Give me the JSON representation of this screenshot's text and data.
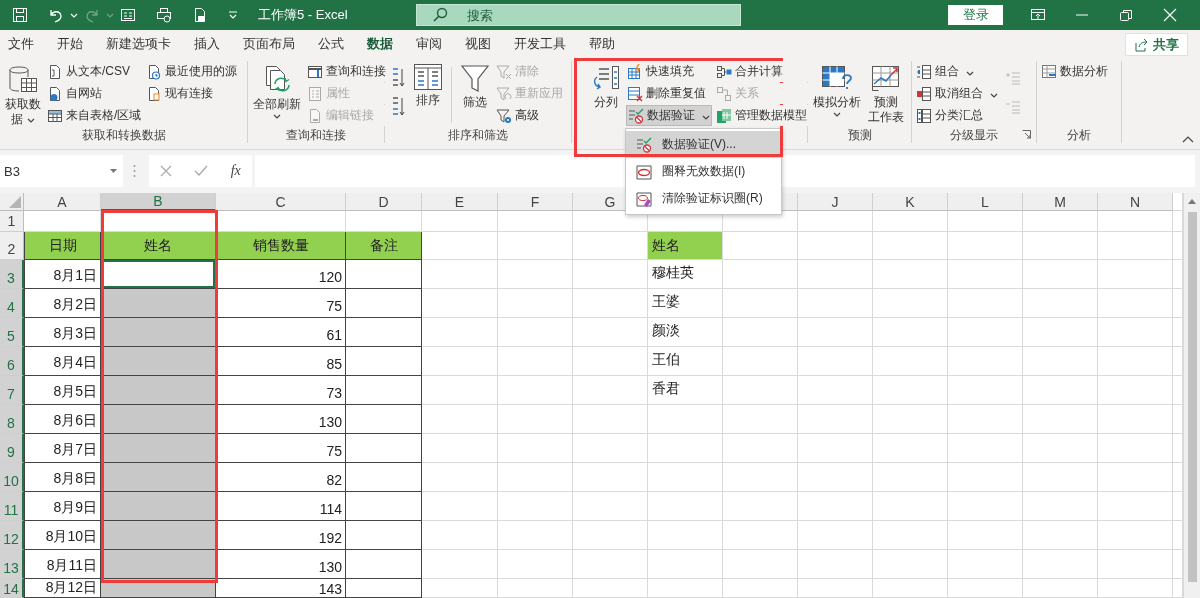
{
  "title_bar": {
    "title": "工作簿5 - Excel",
    "search_placeholder": "搜索",
    "sign_in": "登录"
  },
  "tabs": [
    {
      "label": "文件",
      "selected": false
    },
    {
      "label": "开始",
      "selected": false
    },
    {
      "label": "新建选项卡",
      "selected": false
    },
    {
      "label": "插入",
      "selected": false
    },
    {
      "label": "页面布局",
      "selected": false
    },
    {
      "label": "公式",
      "selected": false
    },
    {
      "label": "数据",
      "selected": true
    },
    {
      "label": "审阅",
      "selected": false
    },
    {
      "label": "视图",
      "selected": false
    },
    {
      "label": "开发工具",
      "selected": false
    },
    {
      "label": "帮助",
      "selected": false
    }
  ],
  "share": "共享",
  "ribbon": {
    "groups": [
      {
        "label": "获取和转换数据",
        "columns": [
          {
            "kind": "large",
            "lines": [
              "获取数",
              "据"
            ],
            "dropdown": true
          },
          {
            "kind": "stack",
            "items": [
              {
                "label": "从文本/CSV",
                "disabled": false
              },
              {
                "label": "自网站",
                "disabled": false
              },
              {
                "label": "来自表格/区域",
                "disabled": false
              }
            ]
          },
          {
            "kind": "stack",
            "items": [
              {
                "label": "最近使用的源",
                "disabled": false
              },
              {
                "label": "现有连接",
                "disabled": false
              }
            ]
          }
        ]
      },
      {
        "label": "查询和连接",
        "columns": [
          {
            "kind": "large",
            "lines": [
              "全部刷新"
            ],
            "dropdown": true
          },
          {
            "kind": "stack",
            "items": [
              {
                "label": "查询和连接",
                "disabled": false
              },
              {
                "label": "属性",
                "disabled": true
              },
              {
                "label": "编辑链接",
                "disabled": true
              }
            ]
          }
        ]
      },
      {
        "label": "排序和筛选",
        "columns": [
          {
            "kind": "icon_stack",
            "items": [
              {
                "disabled": false
              },
              {
                "disabled": false
              }
            ]
          },
          {
            "kind": "large",
            "lines": [
              "排序"
            ],
            "dropdown": false
          },
          {
            "kind": "separator"
          },
          {
            "kind": "large",
            "lines": [
              "筛选"
            ],
            "dropdown": false
          },
          {
            "kind": "stack",
            "items": [
              {
                "label": "清除",
                "disabled": true
              },
              {
                "label": "重新应用",
                "disabled": true
              },
              {
                "label": "高级",
                "disabled": false
              }
            ]
          }
        ]
      },
      {
        "columns": [
          {
            "kind": "large",
            "lines": [
              "分列"
            ],
            "dropdown": false
          },
          {
            "kind": "stack",
            "items": [
              {
                "label": "快速填充",
                "disabled": false
              },
              {
                "label": "删除重复值",
                "disabled": false
              },
              {
                "label": "数据验证",
                "disabled": false,
                "dropdown": true,
                "menu": {
                  "items": [
                    {
                      "label": "数据验证(V)...",
                      "selected": true
                    },
                    {
                      "label": "圈释无效数据(I)",
                      "selected": false
                    },
                    {
                      "label": "清除验证标识圈(R)",
                      "selected": false
                    }
                  ]
                }
              }
            ]
          },
          {
            "kind": "stack",
            "items": [
              {
                "label": "合并计算",
                "disabled": false
              },
              {
                "label": "关系",
                "disabled": true
              },
              {
                "label": "管理数据模型",
                "disabled": false
              }
            ]
          }
        ]
      },
      {
        "label": "预测",
        "columns": [
          {
            "kind": "large",
            "lines": [
              "模拟分析"
            ],
            "dropdown": true
          },
          {
            "kind": "large",
            "lines": [
              "预测",
              "工作表"
            ],
            "dropdown": false
          }
        ]
      },
      {
        "label": "分级显示",
        "launcher": true,
        "columns": [
          {
            "kind": "stack",
            "items": [
              {
                "label": "组合",
                "disabled": false,
                "dropdown": true
              },
              {
                "label": "取消组合",
                "disabled": false,
                "dropdown": true
              },
              {
                "label": "分类汇总",
                "disabled": false
              }
            ]
          },
          {
            "kind": "icon_stack",
            "items": [
              {
                "disabled": true
              },
              {
                "disabled": true
              }
            ]
          }
        ]
      },
      {
        "label": "分析",
        "columns": [
          {
            "kind": "stack",
            "items": [
              {
                "label": "数据分析",
                "disabled": false
              }
            ]
          }
        ]
      }
    ]
  },
  "formula_bar": {
    "name_box": "B3",
    "function_label": "fx"
  },
  "sheet": {
    "columns": [
      {
        "label": "A",
        "selected": false
      },
      {
        "label": "B",
        "selected": true
      },
      {
        "label": "C",
        "selected": false
      },
      {
        "label": "D",
        "selected": false
      },
      {
        "label": "E",
        "selected": false
      },
      {
        "label": "F",
        "selected": false
      },
      {
        "label": "G",
        "selected": false
      }
    ],
    "columns_right": [
      {
        "label": "J",
        "selected": false
      },
      {
        "label": "K",
        "selected": false
      },
      {
        "label": "L",
        "selected": false
      },
      {
        "label": "M",
        "selected": false
      },
      {
        "label": "N",
        "selected": false
      }
    ],
    "rows": [
      {
        "number": "1",
        "kind": "blank",
        "selected": false,
        "active": false
      },
      {
        "number": "2",
        "kind": "header",
        "selected": false,
        "active": false,
        "date": "日期",
        "name": "姓名",
        "quantity": "销售数量",
        "note": "备注",
        "list_item": "姓名"
      },
      {
        "number": "3",
        "kind": "data",
        "selected": true,
        "active": true,
        "date": "8月1日",
        "quantity": "120",
        "list_item": "穆桂英"
      },
      {
        "number": "4",
        "kind": "data",
        "selected": true,
        "active": false,
        "date": "8月2日",
        "quantity": "75",
        "list_item": "王婆"
      },
      {
        "number": "5",
        "kind": "data",
        "selected": true,
        "active": false,
        "date": "8月3日",
        "quantity": "61",
        "list_item": "颜淡"
      },
      {
        "number": "6",
        "kind": "data",
        "selected": true,
        "active": false,
        "date": "8月4日",
        "quantity": "85",
        "list_item": "王伯"
      },
      {
        "number": "7",
        "kind": "data",
        "selected": true,
        "active": false,
        "date": "8月5日",
        "quantity": "73",
        "list_item": "香君"
      },
      {
        "number": "8",
        "kind": "data",
        "selected": true,
        "active": false,
        "date": "8月6日",
        "quantity": "130"
      },
      {
        "number": "9",
        "kind": "data",
        "selected": true,
        "active": false,
        "date": "8月7日",
        "quantity": "75"
      },
      {
        "number": "10",
        "kind": "data",
        "selected": true,
        "active": false,
        "date": "8月8日",
        "quantity": "82"
      },
      {
        "number": "11",
        "kind": "data",
        "selected": true,
        "active": false,
        "date": "8月9日",
        "quantity": "114"
      },
      {
        "number": "12",
        "kind": "data",
        "selected": true,
        "active": false,
        "date": "8月10日",
        "quantity": "192"
      },
      {
        "number": "13",
        "kind": "data",
        "selected": true,
        "active": false,
        "date": "8月11日",
        "quantity": "130"
      },
      {
        "number": "14",
        "kind": "data",
        "selected": true,
        "active": false,
        "date": "8月12日",
        "quantity": "143"
      }
    ]
  }
}
